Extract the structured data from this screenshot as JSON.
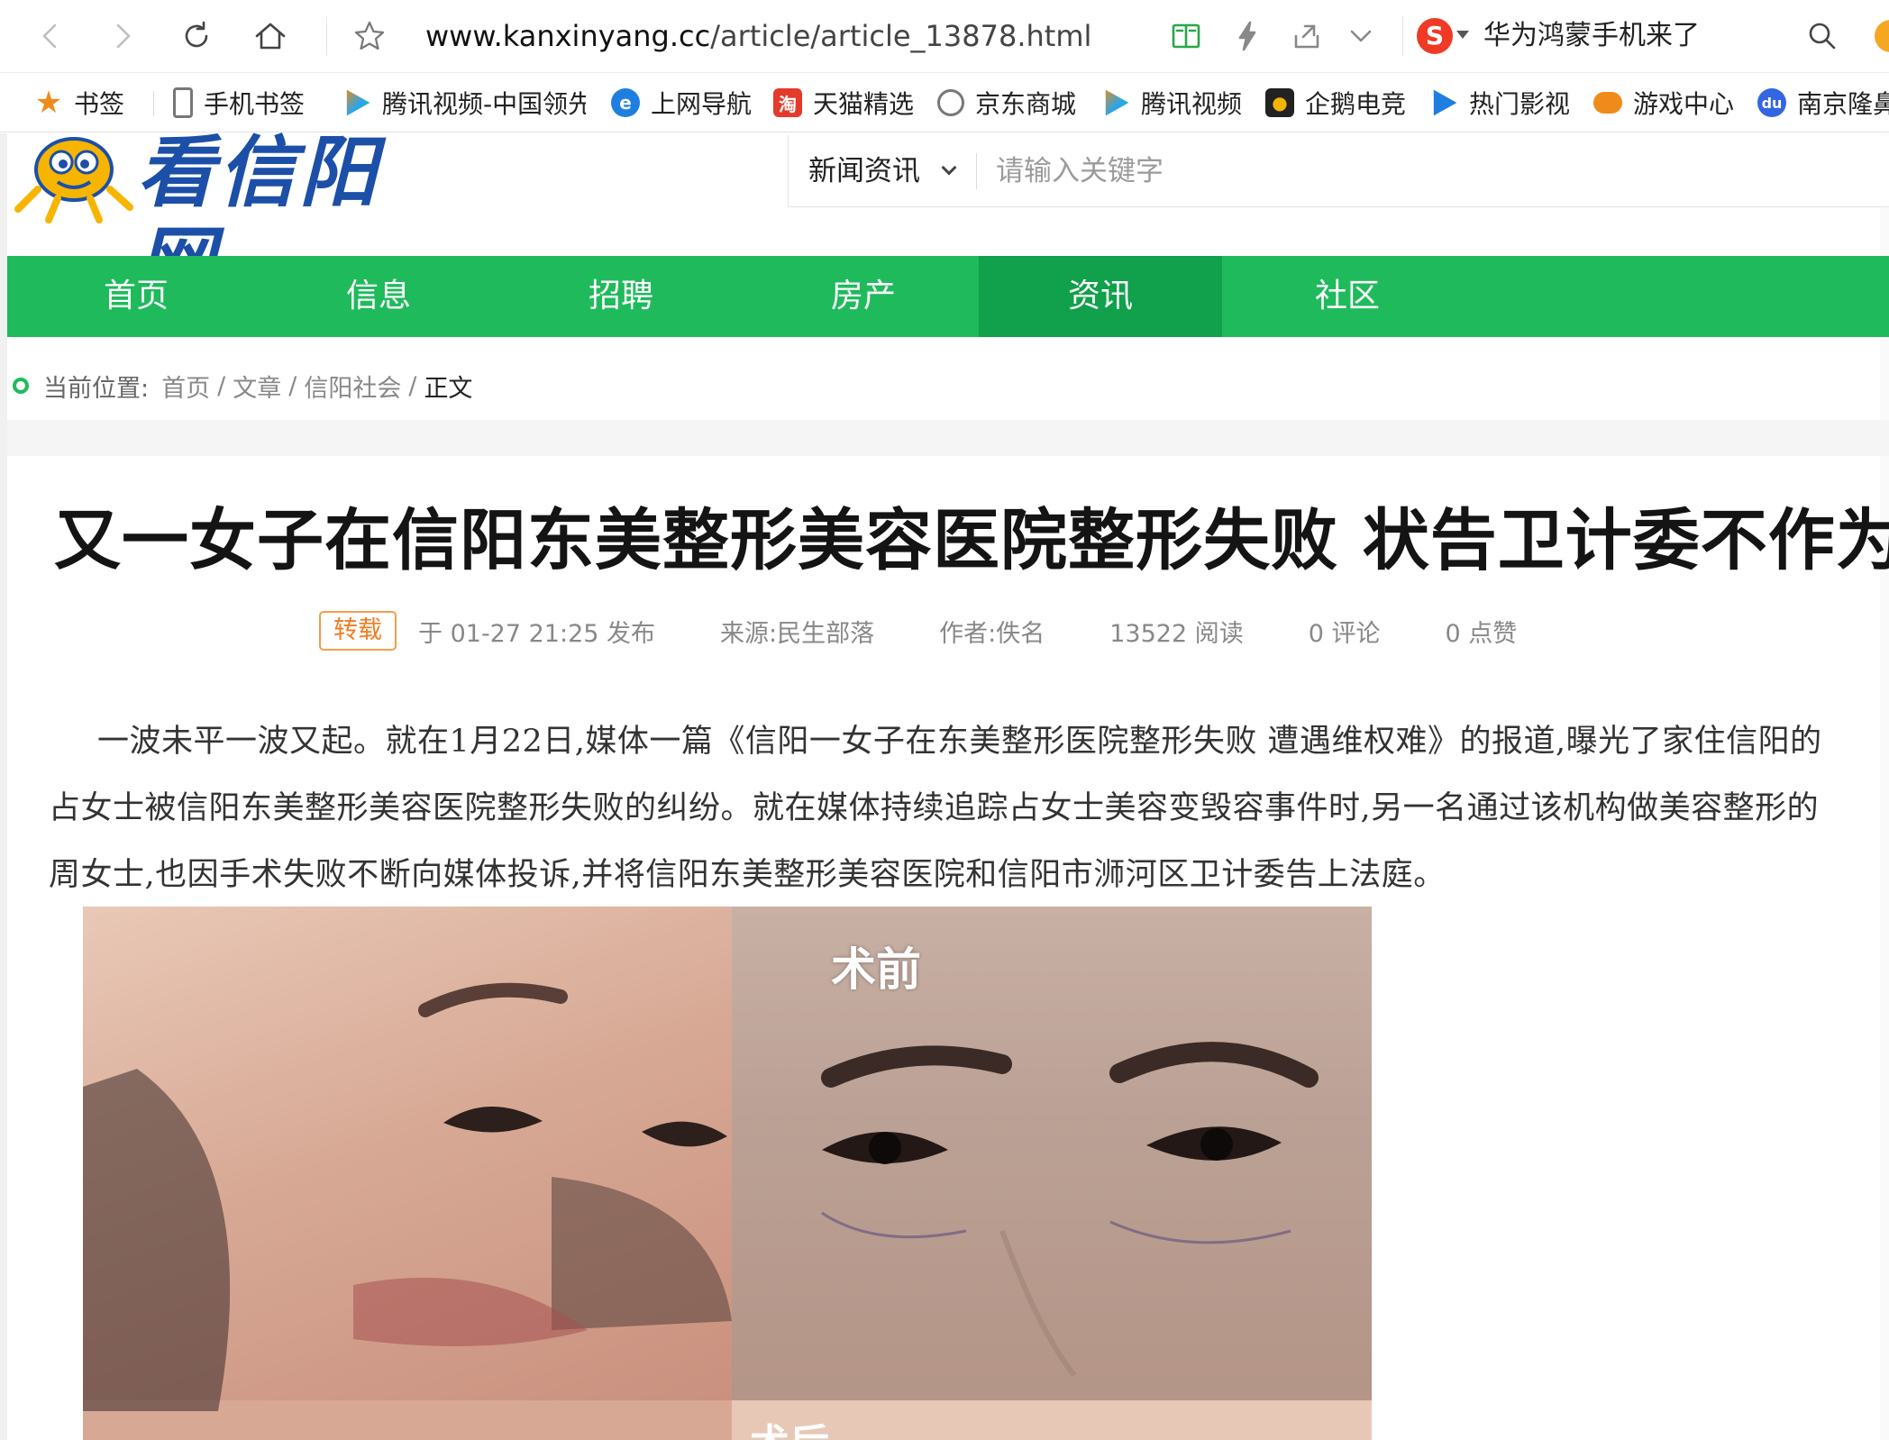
{
  "browser": {
    "url_host": "www.kanxinyang.cc",
    "url_path": "/article/article_13878.html",
    "search_engine_logo": "S",
    "hot_search": "华为鸿蒙手机来了",
    "icons": [
      "back-icon",
      "forward-icon",
      "reload-icon",
      "home-icon",
      "star-icon",
      "reader-icon",
      "lightning-icon",
      "share-icon",
      "chevron-down-icon",
      "search-icon"
    ]
  },
  "bookmarks": [
    {
      "label": "书签",
      "icon": "star-icon",
      "color": "#f08a1b"
    },
    {
      "label": "手机书签",
      "icon": "phone-icon",
      "color": "#666666"
    },
    {
      "label": "腾讯视频-中国领先",
      "icon": "tencent-video-icon",
      "color": "#22a6f2"
    },
    {
      "label": "上网导航",
      "icon": "ie-icon",
      "color": "#1f7fe0"
    },
    {
      "label": "天猫精选",
      "icon": "tmall-icon",
      "color": "#e53a2a"
    },
    {
      "label": "京东商城",
      "icon": "globe-icon",
      "color": "#666666"
    },
    {
      "label": "腾讯视频",
      "icon": "tencent-video-icon",
      "color": "#22a6f2"
    },
    {
      "label": "企鹅电竞",
      "icon": "penguin-icon",
      "color": "#f5b400"
    },
    {
      "label": "热门影视",
      "icon": "play-icon",
      "color": "#1f7fe0"
    },
    {
      "label": "游戏中心",
      "icon": "gamepad-icon",
      "color": "#f08a1b"
    },
    {
      "label": "南京隆鼻",
      "icon": "baidu-icon",
      "color": "#3366e0"
    }
  ],
  "site": {
    "logo_text": "看信阳网",
    "search_category": "新闻资讯",
    "search_placeholder": "请输入关键字"
  },
  "nav": [
    {
      "label": "首页",
      "active": false
    },
    {
      "label": "信息",
      "active": false
    },
    {
      "label": "招聘",
      "active": false
    },
    {
      "label": "房产",
      "active": false
    },
    {
      "label": "资讯",
      "active": true
    },
    {
      "label": "社区",
      "active": false
    }
  ],
  "breadcrumb": {
    "prefix": "当前位置:",
    "items": [
      "首页",
      "文章",
      "信阳社会"
    ],
    "current": "正文"
  },
  "article": {
    "title": "又一女子在信阳东美整形美容医院整形失败 状告卫计委不作为",
    "badge": "转载",
    "published": "于 01-27 21:25 发布",
    "source": "来源:民生部落",
    "author": "作者:佚名",
    "reads": "13522 阅读",
    "comments": "0 评论",
    "likes": "0 点赞",
    "body": "一波未平一波又起。就在1月22日,媒体一篇《信阳一女子在东美整形医院整形失败 遭遇维权难》的报道,曝光了家住信阳的占女士被信阳东美整形美容医院整形失败的纠纷。就在媒体持续追踪占女士美容变毁容事件时,另一名通过该机构做美容整形的周女士,也因手术失败不断向媒体投诉,并将信阳东美整形美容医院和信阳市浉河区卫计委告上法庭。",
    "photo_label": "术前",
    "photo_label_2": "术后"
  },
  "colors": {
    "nav_green": "#1fba5c",
    "nav_active": "#11a04b",
    "badge_orange": "#f27c1f",
    "logo_blue": "#1c4fa8"
  }
}
